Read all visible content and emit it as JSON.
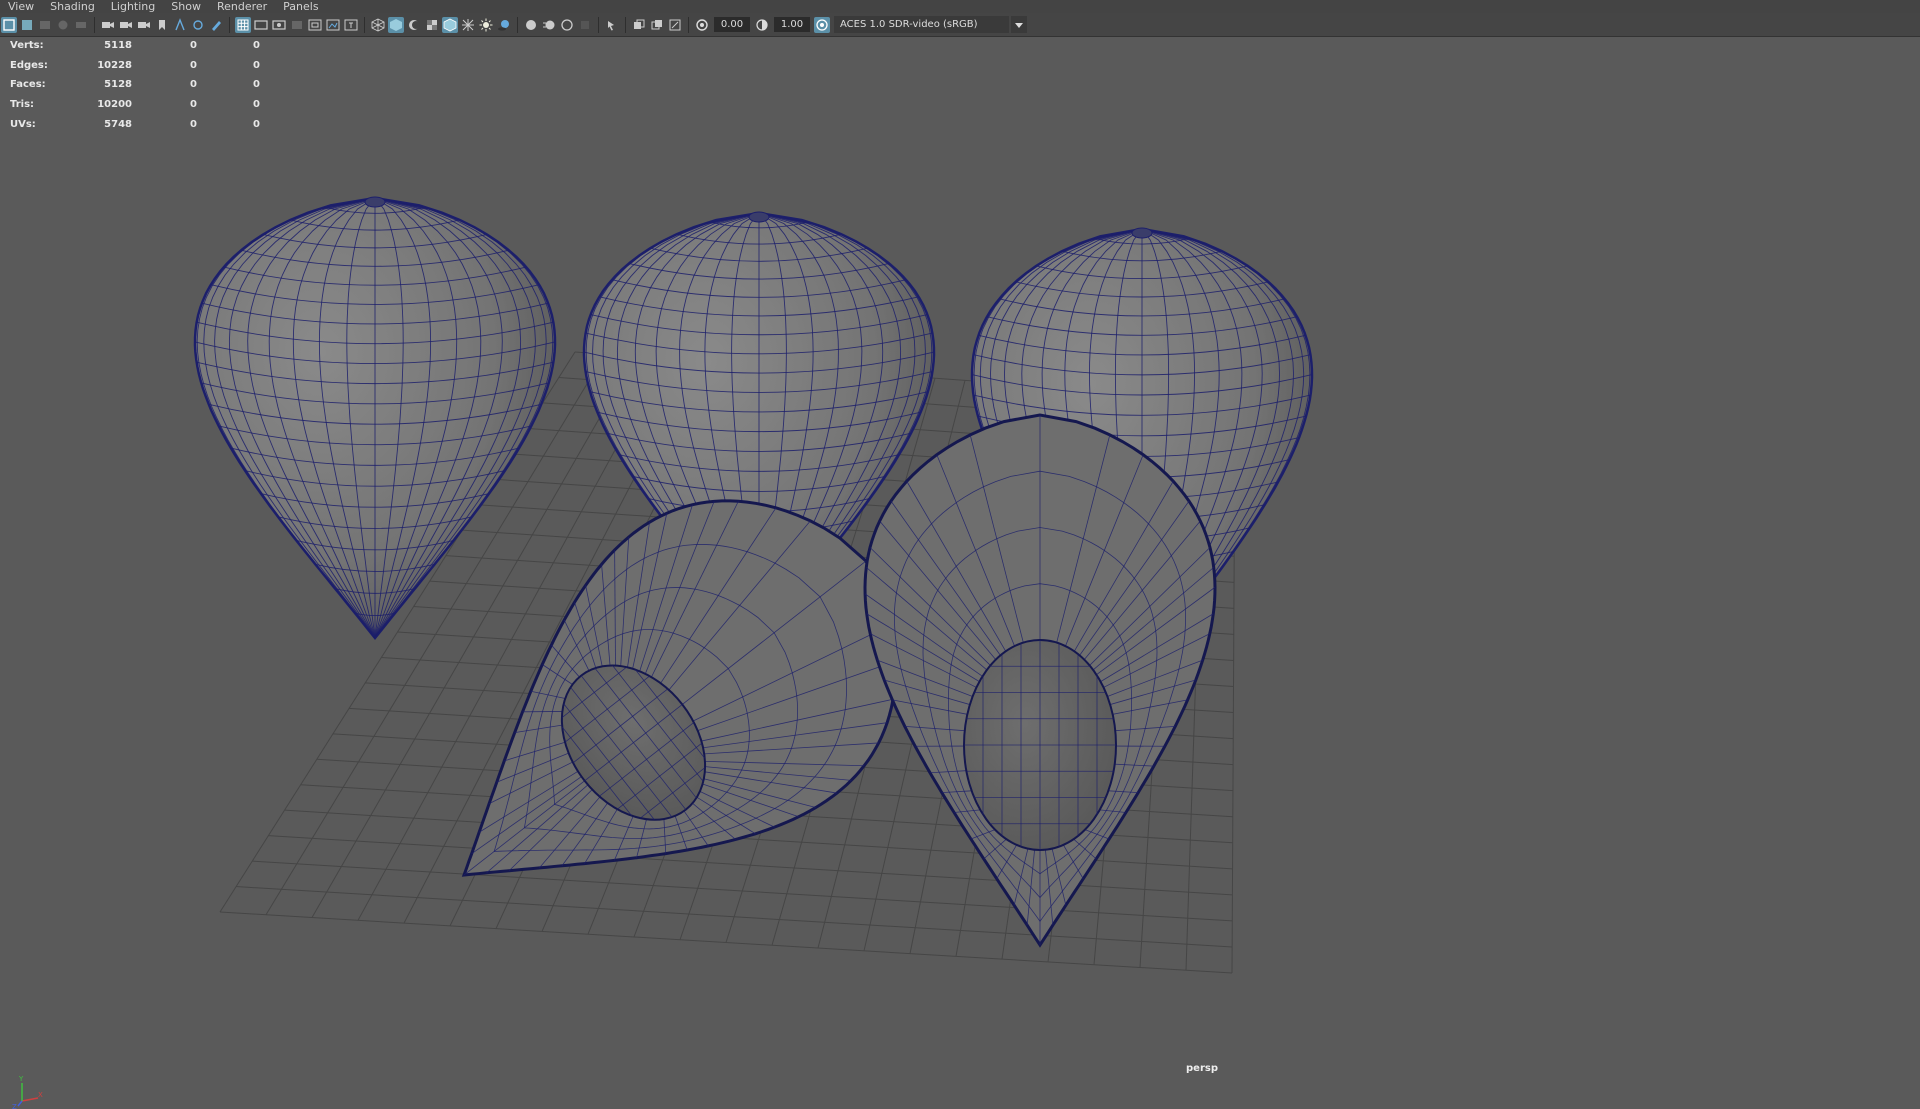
{
  "menu": {
    "items": [
      "View",
      "Shading",
      "Lighting",
      "Show",
      "Renderer",
      "Panels"
    ]
  },
  "toolbar": {
    "exposure_value": "0.00",
    "gamma_value": "1.00",
    "color_management_label": "ACES 1.0 SDR-video (sRGB)"
  },
  "hud": {
    "rows": [
      {
        "label": "Verts:",
        "v1": "5118",
        "v2": "0",
        "v3": "0"
      },
      {
        "label": "Edges:",
        "v1": "10228",
        "v2": "0",
        "v3": "0"
      },
      {
        "label": "Faces:",
        "v1": "5128",
        "v2": "0",
        "v3": "0"
      },
      {
        "label": "Tris:",
        "v1": "10200",
        "v2": "0",
        "v3": "0"
      },
      {
        "label": "UVs:",
        "v1": "5748",
        "v2": "0",
        "v3": "0"
      }
    ]
  },
  "viewport": {
    "camera": "persp"
  },
  "colors": {
    "background": "#5a5a5a",
    "wire": "#1c1f6b",
    "mesh": "#767676",
    "active_icon": "#5b90a8"
  },
  "icons": [
    "select-icon",
    "camera-icon",
    "grid-icon",
    "shaded-icon",
    "light-icon",
    "isolate-icon",
    "exposure-icon",
    "gamma-icon",
    "color-management-icon"
  ]
}
